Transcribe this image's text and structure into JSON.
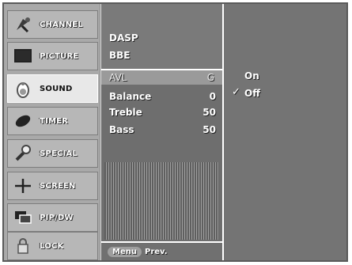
{
  "sidebar": {
    "items": [
      {
        "label": "CHANNEL",
        "icon": "satellite-dish-icon"
      },
      {
        "label": "PICTURE",
        "icon": "monitor-icon"
      },
      {
        "label": "SOUND",
        "icon": "speaker-icon",
        "active": true
      },
      {
        "label": "TIMER",
        "icon": "clock-icon"
      },
      {
        "label": "SPECIAL",
        "icon": "wrench-icon"
      },
      {
        "label": "SCREEN",
        "icon": "crosshair-icon"
      },
      {
        "label": "PIP/DW",
        "icon": "pip-windows-icon"
      },
      {
        "label": "LOCK",
        "icon": "lock-icon"
      }
    ]
  },
  "menu": {
    "dasp": "DASP",
    "bbe": "BBE",
    "avl_label": "AVL",
    "avl_marker": "G",
    "balance_label": "Balance",
    "balance_value": "0",
    "treble_label": "Treble",
    "treble_value": "50",
    "bass_label": "Bass",
    "bass_value": "50"
  },
  "bottom": {
    "menu_label": "Menu",
    "prev_label": "Prev."
  },
  "options": {
    "on_label": "On",
    "off_label": "Off",
    "check_mark": "✓",
    "selected": "Off"
  }
}
